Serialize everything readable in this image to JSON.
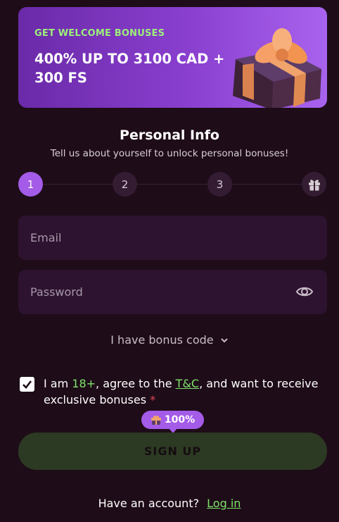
{
  "banner": {
    "eyebrow": "GET WELCOME BONUSES",
    "title": "400% UP TO 3100 CAD + 300 FS",
    "icon": "gift-box-icon"
  },
  "form": {
    "heading": "Personal Info",
    "subheading": "Tell us about yourself to unlock personal bonuses!",
    "steps": [
      "1",
      "2",
      "3"
    ],
    "active_step": 1,
    "final_step_icon": "gift-icon",
    "email_placeholder": "Email",
    "password_placeholder": "Password",
    "password_toggle_icon": "eye-icon",
    "bonus_code_label": "I have bonus code",
    "terms": {
      "checked": true,
      "prefix": "I am ",
      "age": "18+",
      "middle": ", agree to the ",
      "link": "T&C",
      "suffix": ", and want to receive exclusive bonuses",
      "required_mark": "*"
    },
    "progress_badge": "100%",
    "signup_label": "SIGN UP",
    "have_account_text": "Have an account?",
    "login_label": "Log in"
  },
  "colors": {
    "background": "#1e0c18",
    "accent_purple": "#a45be8",
    "accent_green": "#7ee36a",
    "field_bg": "#2e1330"
  }
}
